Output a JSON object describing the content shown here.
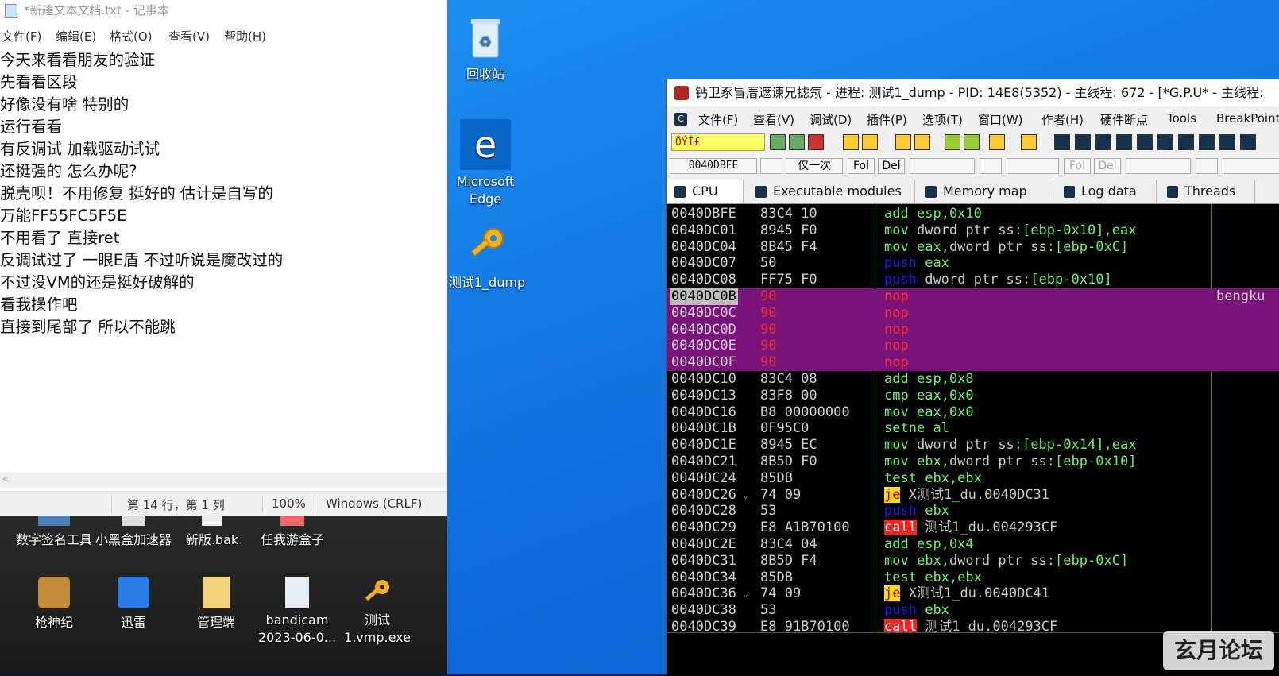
{
  "notepad": {
    "title": "*新建文本文档.txt - 记事本",
    "menu": [
      "文件(F)",
      "编辑(E)",
      "格式(O)",
      "查看(V)",
      "帮助(H)"
    ],
    "lines": [
      "今天来看看朋友的验证",
      "先看看区段",
      "好像没有啥 特别的",
      "运行看看",
      "有反调试 加载驱动试试",
      "还挺强的 怎么办呢?",
      "脱壳呗！不用修复 挺好的 估计是自写的",
      "万能FF55FC5F5E",
      "不用看了 直接ret",
      "反调试过了 一眼E盾 不过听说是魔改过的",
      "不过没VM的还是挺好破解的",
      "看我操作吧",
      "直接到尾部了 所以不能跳"
    ],
    "status": {
      "position": "第 14 行，第 1 列",
      "zoom": "100%",
      "eol": "Windows (CRLF)"
    }
  },
  "desktop": {
    "icons": [
      {
        "label": "回收站",
        "icon": "recycle-bin-icon"
      },
      {
        "label": "Microsoft Edge",
        "icon": "edge-icon"
      },
      {
        "label": "测试1_dump",
        "icon": "key-icon"
      }
    ],
    "lower_row1": [
      "数字签名工具",
      "小黑盒加速器",
      "新版.bak",
      "任我游盒子"
    ],
    "lower_row2": [
      {
        "label": "枪神纪"
      },
      {
        "label": "迅雷"
      },
      {
        "label": "管理端"
      },
      {
        "label": "bandicam 2023-06-0..."
      },
      {
        "label": "测试 1.vmp.exe"
      }
    ]
  },
  "debugger": {
    "title": "钙卫豖冒厝遮谏兄摅氖 - 进程: 测试1_dump - PID: 14E8(5352) - 主线程: 672 - [*G.P.U* -  主线程: ",
    "menu": [
      "文件(F)",
      "查看(V)",
      "调试(D)",
      "插件(P)",
      "选项(T)",
      "窗口(W)",
      "作者(H)",
      "硬件断点",
      "Tools",
      "BreakPoint"
    ],
    "command_text": "ÔÝÍ£",
    "address_box": "0040DBFE",
    "once_label": "仅一次",
    "fol_label": "Fol",
    "del_label": "Del",
    "tabs": [
      "CPU",
      "Executable modules",
      "Memory map",
      "Log data",
      "Threads"
    ],
    "comment_nop": "bengku",
    "rows": [
      {
        "addr": "0040DBFE",
        "bytes": "83C4 10",
        "mn": "add",
        "ops": "esp,0x10"
      },
      {
        "addr": "0040DC01",
        "bytes": "8945 F0",
        "mn": "mov",
        "ops": "dword ptr ss:[ebp-0x10],eax"
      },
      {
        "addr": "0040DC04",
        "bytes": "8B45 F4",
        "mn": "mov",
        "ops": "eax,dword ptr ss:[ebp-0xC]"
      },
      {
        "addr": "0040DC07",
        "bytes": "50",
        "mn": "push",
        "ops": "eax"
      },
      {
        "addr": "0040DC08",
        "bytes": "FF75 F0",
        "mn": "push",
        "ops": "dword ptr ss:[ebp-0x10]"
      },
      {
        "addr": "0040DC0B",
        "bytes": "90",
        "mn": "nop",
        "ops": ""
      },
      {
        "addr": "0040DC0C",
        "bytes": "90",
        "mn": "nop",
        "ops": ""
      },
      {
        "addr": "0040DC0D",
        "bytes": "90",
        "mn": "nop",
        "ops": ""
      },
      {
        "addr": "0040DC0E",
        "bytes": "90",
        "mn": "nop",
        "ops": ""
      },
      {
        "addr": "0040DC0F",
        "bytes": "90",
        "mn": "nop",
        "ops": ""
      },
      {
        "addr": "0040DC10",
        "bytes": "83C4 08",
        "mn": "add",
        "ops": "esp,0x8"
      },
      {
        "addr": "0040DC13",
        "bytes": "83F8 00",
        "mn": "cmp",
        "ops": "eax,0x0"
      },
      {
        "addr": "0040DC16",
        "bytes": "B8 00000000",
        "mn": "mov",
        "ops": "eax,0x0"
      },
      {
        "addr": "0040DC1B",
        "bytes": "0F95C0",
        "mn": "setne",
        "ops": "al"
      },
      {
        "addr": "0040DC1E",
        "bytes": "8945 EC",
        "mn": "mov",
        "ops": "dword ptr ss:[ebp-0x14],eax"
      },
      {
        "addr": "0040DC21",
        "bytes": "8B5D F0",
        "mn": "mov",
        "ops": "ebx,dword ptr ss:[ebp-0x10]"
      },
      {
        "addr": "0040DC24",
        "bytes": "85DB",
        "mn": "test",
        "ops": "ebx,ebx"
      },
      {
        "addr": "0040DC26",
        "bytes": "74 09",
        "mn": "je",
        "ops": "X测试1_du.0040DC31"
      },
      {
        "addr": "0040DC28",
        "bytes": "53",
        "mn": "push",
        "ops": "ebx"
      },
      {
        "addr": "0040DC29",
        "bytes": "E8 A1B70100",
        "mn": "call",
        "ops": "测试1_du.004293CF"
      },
      {
        "addr": "0040DC2E",
        "bytes": "83C4 04",
        "mn": "add",
        "ops": "esp,0x4"
      },
      {
        "addr": "0040DC31",
        "bytes": "8B5D F4",
        "mn": "mov",
        "ops": "ebx,dword ptr ss:[ebp-0xC]"
      },
      {
        "addr": "0040DC34",
        "bytes": "85DB",
        "mn": "test",
        "ops": "ebx,ebx"
      },
      {
        "addr": "0040DC36",
        "bytes": "74 09",
        "mn": "je",
        "ops": "X测试1_du.0040DC41"
      },
      {
        "addr": "0040DC38",
        "bytes": "53",
        "mn": "push",
        "ops": "ebx"
      },
      {
        "addr": "0040DC39",
        "bytes": "E8 91B70100",
        "mn": "call",
        "ops": "测试1_du.004293CF"
      }
    ]
  },
  "watermark": "玄月论坛"
}
